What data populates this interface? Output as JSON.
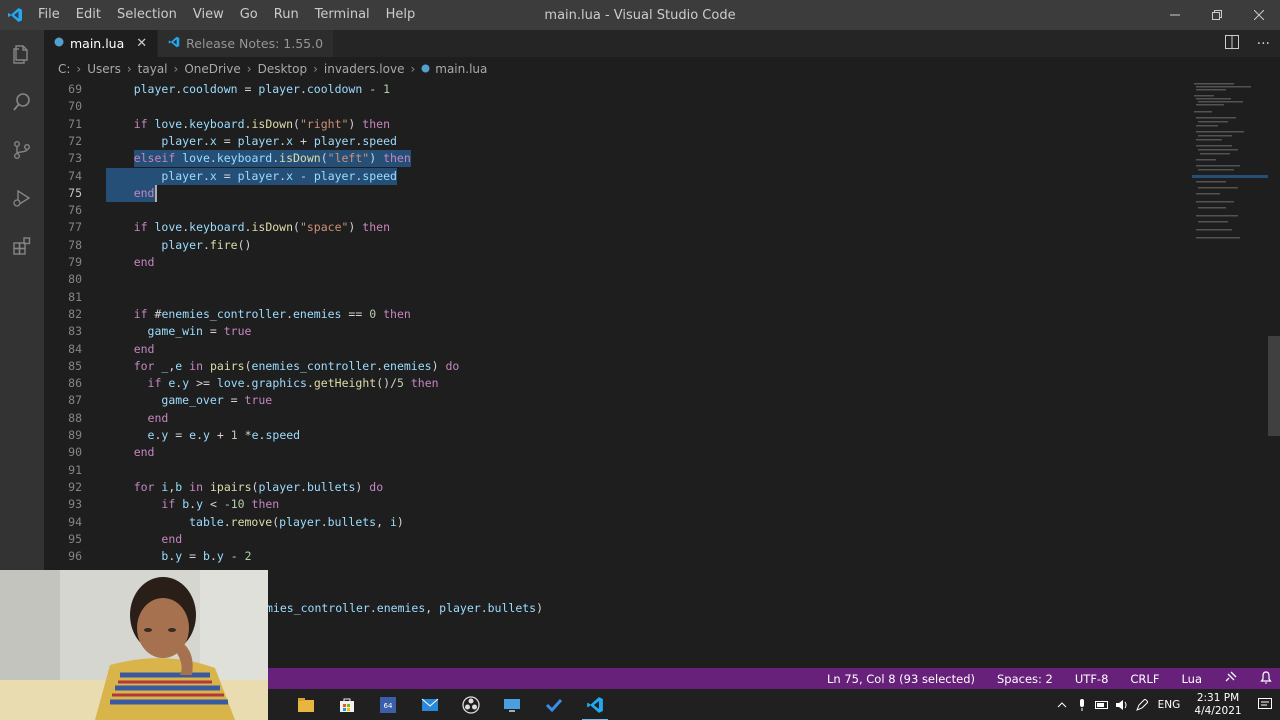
{
  "titlebar": {
    "menu": [
      "File",
      "Edit",
      "Selection",
      "View",
      "Go",
      "Run",
      "Terminal",
      "Help"
    ],
    "title": "main.lua - Visual Studio Code"
  },
  "tabs": [
    {
      "label": "main.lua",
      "active": true
    },
    {
      "label": "Release Notes: 1.55.0",
      "active": false
    }
  ],
  "breadcrumb": [
    "C:",
    "Users",
    "tayal",
    "OneDrive",
    "Desktop",
    "invaders.love",
    "main.lua"
  ],
  "editor": {
    "lines": [
      {
        "n": "69",
        "text": "    player.cooldown = player.cooldown - 1"
      },
      {
        "n": "70",
        "text": ""
      },
      {
        "n": "71",
        "text": "    if love.keyboard.isDown(\"right\") then"
      },
      {
        "n": "72",
        "text": "        player.x = player.x + player.speed"
      },
      {
        "n": "73",
        "text": "    elseif love.keyboard.isDown(\"left\") then"
      },
      {
        "n": "74",
        "text": "        player.x = player.x - player.speed"
      },
      {
        "n": "75",
        "text": "    end"
      },
      {
        "n": "76",
        "text": ""
      },
      {
        "n": "77",
        "text": "    if love.keyboard.isDown(\"space\") then"
      },
      {
        "n": "78",
        "text": "        player.fire()"
      },
      {
        "n": "79",
        "text": "    end"
      },
      {
        "n": "80",
        "text": ""
      },
      {
        "n": "81",
        "text": ""
      },
      {
        "n": "82",
        "text": "    if #enemies_controller.enemies == 0 then"
      },
      {
        "n": "83",
        "text": "      game_win = true"
      },
      {
        "n": "84",
        "text": "    end"
      },
      {
        "n": "85",
        "text": "    for _,e in pairs(enemies_controller.enemies) do"
      },
      {
        "n": "86",
        "text": "      if e.y >= love.graphics.getHeight()/5 then"
      },
      {
        "n": "87",
        "text": "        game_over = true"
      },
      {
        "n": "88",
        "text": "      end"
      },
      {
        "n": "89",
        "text": "      e.y = e.y + 1 *e.speed"
      },
      {
        "n": "90",
        "text": "    end"
      },
      {
        "n": "91",
        "text": ""
      },
      {
        "n": "92",
        "text": "    for i,b in ipairs(player.bullets) do"
      },
      {
        "n": "93",
        "text": "        if b.y < -10 then"
      },
      {
        "n": "94",
        "text": "            table.remove(player.bullets, i)"
      },
      {
        "n": "95",
        "text": "        end"
      },
      {
        "n": "96",
        "text": "        b.y = b.y - 2"
      }
    ],
    "partial_line": "mies_controller.enemies, player.bullets)"
  },
  "statusbar": {
    "position": "Ln 75, Col 8 (93 selected)",
    "spaces": "Spaces: 2",
    "encoding": "UTF-8",
    "eol": "CRLF",
    "language": "Lua"
  },
  "taskbar": {
    "lang": "ENG",
    "time": "2:31 PM",
    "date": "4/4/2021"
  },
  "colors": {
    "statusbar": "#68217a",
    "selection": "#264f78",
    "keyword": "#c586c0",
    "string": "#ce9178"
  }
}
